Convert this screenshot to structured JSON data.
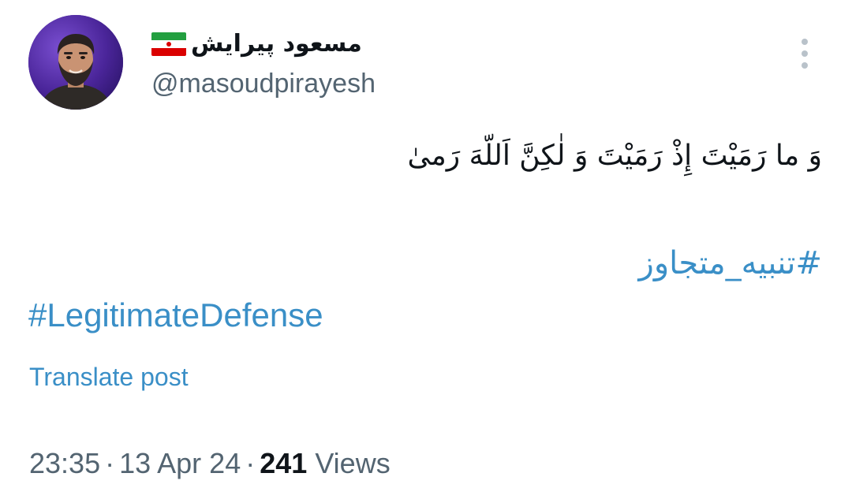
{
  "author": {
    "display_name": "مسعود پیرایش",
    "handle": "@masoudpirayesh",
    "flag_icon": "iran-flag-icon",
    "avatar_icon": "profile-photo-icon"
  },
  "more_icon": "more-vertical-icon",
  "post": {
    "verse": "وَ ما رَمَیْتَ إِذْ رَمَیْتَ وَ لٰکِنَّ اَللّهَ رَمیٰ",
    "hashtag_fa": "#تنبیه_متجاوز",
    "hashtag_en": "#LegitimateDefense",
    "translate_label": "Translate post"
  },
  "meta": {
    "time": "23:35",
    "sep1": "·",
    "date": "13 Apr 24",
    "sep2": "·",
    "views_count": "241",
    "views_label": "Views"
  },
  "colors": {
    "link": "#3a8fc7",
    "secondary_text": "#536471",
    "primary_text": "#0f1419"
  }
}
